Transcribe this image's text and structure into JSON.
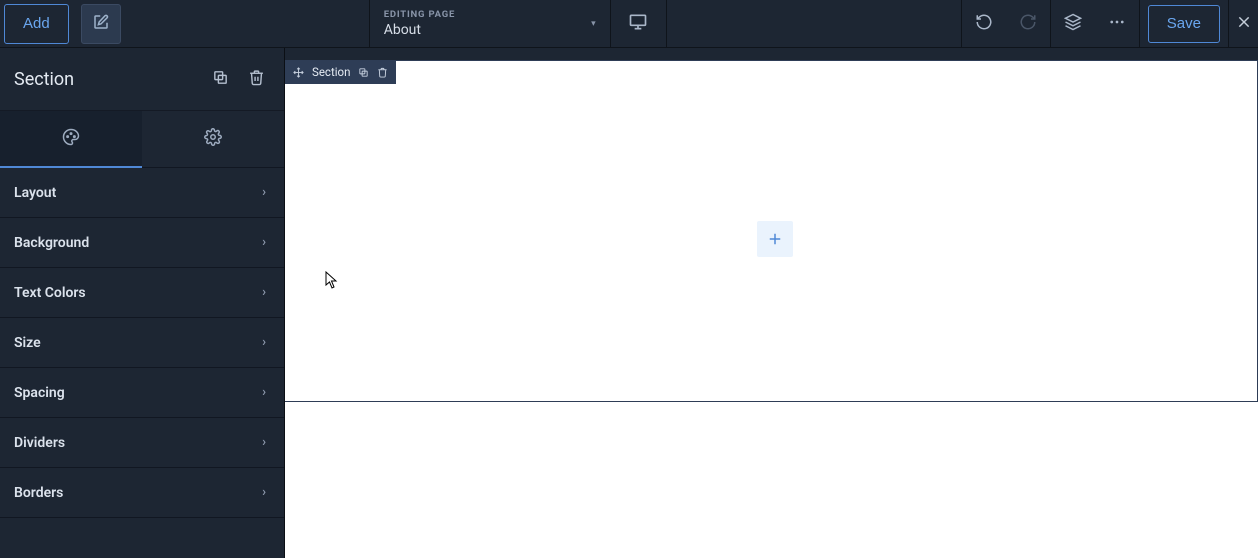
{
  "topbar": {
    "add_label": "Add",
    "editing_label": "EDITING PAGE",
    "page_name": "About",
    "save_label": "Save"
  },
  "panel": {
    "title": "Section"
  },
  "options": [
    "Layout",
    "Background",
    "Text Colors",
    "Size",
    "Spacing",
    "Dividers",
    "Borders"
  ],
  "canvas": {
    "section_badge_label": "Section"
  }
}
